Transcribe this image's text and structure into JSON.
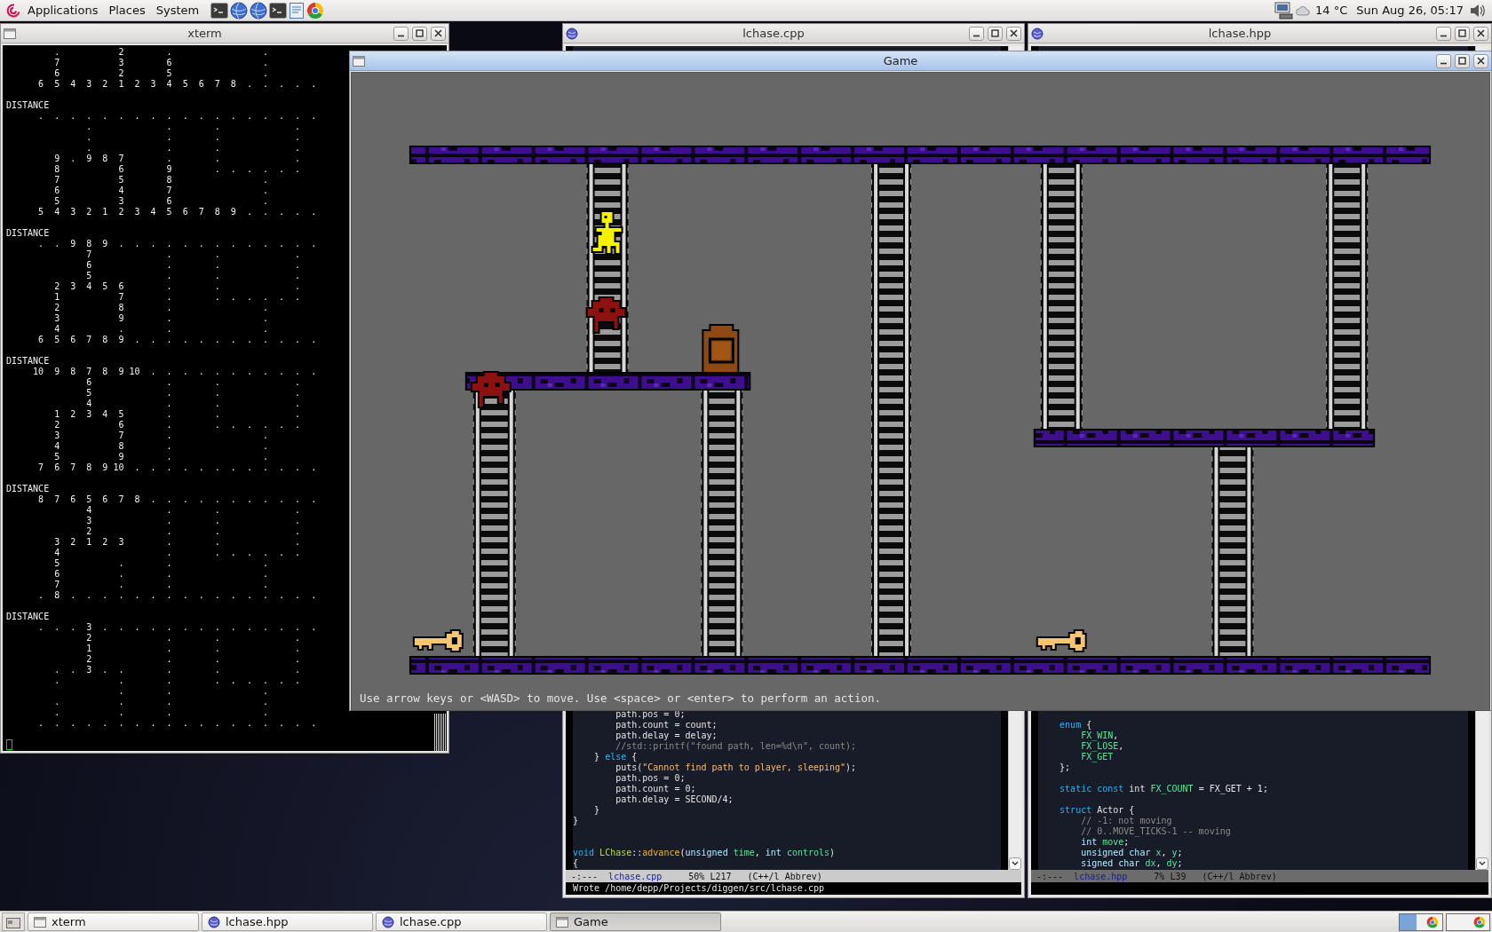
{
  "top_panel": {
    "menus": [
      {
        "label": "Applications"
      },
      {
        "label": "Places"
      },
      {
        "label": "System"
      }
    ],
    "launchers": [
      {
        "kind": "terminal"
      },
      {
        "kind": "globe"
      },
      {
        "kind": "globe"
      },
      {
        "kind": "terminal"
      },
      {
        "kind": "editor"
      },
      {
        "kind": "wheel"
      }
    ],
    "weather": "14 °C",
    "clock": "Sun Aug 26, 05:17"
  },
  "windows": [
    {
      "kind": "terminal",
      "title": "xterm",
      "focused": false,
      "blocks": [
        {
          "lines": [
            "         .           2        .                 .",
            "         7           3        6                 .",
            "         6           2        5                 .",
            "      6  5  4  3  2  1  2  3  4  5  6  7  8  .  .  .  .  ."
          ]
        },
        {
          "heading": "DISTANCE",
          "lines": [
            "      .  .  .  .  .  .  .  .  .  .  .  .  .  .  .  .  .  .",
            "               .              .        .              .",
            "               .              .        .              .",
            "               .              .        .              .",
            "         9  .  9  8  7        .        .              .",
            "         8           6        9        .  .  .  .  .  .",
            "         7           5        8                 .",
            "         6           4        7                 .",
            "         5           3        6                 .",
            "      5  4  3  2  1  2  3  4  5  6  7  8  9  .  .  .  .  ."
          ]
        },
        {
          "heading": "DISTANCE",
          "lines": [
            "      .  .  9  8  9  .  .  .  .  .  .  .  .  .  .  .  .  .",
            "               7              .        .              .",
            "               6              .        .              .",
            "               5              .        .              .",
            "         2  3  4  5  6        .        .              .",
            "         1           7        .        .  .  .  .  .  .",
            "         2           8        .                 .",
            "         3           9        .                 .",
            "         4           .        .                 .",
            "      6  5  6  7  8  9  .  .  .  .  .  .  .  .  .  .  .  ."
          ]
        },
        {
          "heading": "DISTANCE",
          "lines": [
            "     10  9  8  7  8  9 10  .  .  .  .  .  .  .  .  .  .  .",
            "               6              .        .              .",
            "               5              .        .              .",
            "               4              .        .              .",
            "         1  2  3  4  5        .        .              .",
            "         2           6        .        .  .  .  .  .  .",
            "         3           7        .                 .",
            "         4           8        .                 .",
            "         5           9        .                 .",
            "      7  6  7  8  9 10  .  .  .  .  .  .  .  .  .  .  .  ."
          ]
        },
        {
          "heading": "DISTANCE",
          "lines": [
            "      8  7  6  5  6  7  8  .  .  .  .  .  .  .  .  .  .  .",
            "               4              .        .              .",
            "               3              .        .              .",
            "               2              .        .              .",
            "         3  2  1  2  3        .        .              .",
            "         4                    .        .  .  .  .  .  .",
            "         5           .        .                 .",
            "         6           .        .                 .",
            "         7           .        .                 .",
            "      .  8  .  .  .  .  .  .  .  .  .  .  .  .  .  .  .  ."
          ]
        },
        {
          "heading": "DISTANCE",
          "lines": [
            "      .  .  .  3  .  .  .  .  .  .  .  .  .  .  .  .  .  .",
            "               2              .        .              .",
            "               1              .        .              .",
            "               2              .        .              .",
            "         .  .  3  .  .        .        .              .",
            "         .           .        .        .  .  .  .  .  .",
            "                     .        .                 .",
            "         .           .        .                 .",
            "         .           .        .                 .",
            "      .  .  .  .  .  .  .  .  .  .  .  .  .  .  .  .  .  ."
          ]
        }
      ]
    },
    {
      "kind": "editor",
      "title": "lchase.cpp",
      "focused": false,
      "code": [
        {
          "kind": "code",
          "tokens": [
            {
              "text": "        path.pos = 0;",
              "kind": "plain"
            }
          ]
        },
        {
          "kind": "code",
          "tokens": [
            {
              "text": "        path.count = count;",
              "kind": "plain"
            }
          ]
        },
        {
          "kind": "code",
          "tokens": [
            {
              "text": "        path.delay = delay;",
              "kind": "plain"
            }
          ]
        },
        {
          "kind": "code",
          "tokens": [
            {
              "text": "        //std::printf(\"found path, len=%d\\n\", count);",
              "kind": "comment"
            }
          ]
        },
        {
          "kind": "code",
          "tokens": [
            {
              "text": "    } ",
              "kind": "plain"
            },
            {
              "text": "else",
              "kind": "keyword"
            },
            {
              "text": " {",
              "kind": "plain"
            }
          ]
        },
        {
          "kind": "code",
          "tokens": [
            {
              "text": "        puts(",
              "kind": "plain"
            },
            {
              "text": "\"Cannot find path to player, sleeping\"",
              "kind": "string"
            },
            {
              "text": ");",
              "kind": "plain"
            }
          ]
        },
        {
          "kind": "code",
          "tokens": [
            {
              "text": "        path.pos = 0;",
              "kind": "plain"
            }
          ]
        },
        {
          "kind": "code",
          "tokens": [
            {
              "text": "        path.count = 0;",
              "kind": "plain"
            }
          ]
        },
        {
          "kind": "code",
          "tokens": [
            {
              "text": "        path.delay = SECOND/4;",
              "kind": "plain"
            }
          ]
        },
        {
          "kind": "code",
          "tokens": [
            {
              "text": "    }",
              "kind": "plain"
            }
          ]
        },
        {
          "kind": "code",
          "tokens": [
            {
              "text": "}",
              "kind": "plain"
            }
          ]
        },
        {
          "kind": "blank"
        },
        {
          "kind": "blank"
        },
        {
          "kind": "code",
          "tokens": [
            {
              "text": "void",
              "kind": "keyword"
            },
            {
              "text": " LChase",
              "kind": "class"
            },
            {
              "text": "::",
              "kind": "plain"
            },
            {
              "text": "advance",
              "kind": "function"
            },
            {
              "text": "(",
              "kind": "plain"
            },
            {
              "text": "unsigned",
              "kind": "type"
            },
            {
              "text": " time",
              "kind": "variable"
            },
            {
              "text": ", ",
              "kind": "plain"
            },
            {
              "text": "int",
              "kind": "type"
            },
            {
              "text": " controls",
              "kind": "variable"
            },
            {
              "text": ")",
              "kind": "plain"
            }
          ]
        },
        {
          "kind": "code",
          "tokens": [
            {
              "text": "{",
              "kind": "plain"
            }
          ]
        }
      ],
      "modeline": {
        "status": "-:---",
        "buffer": "lchase.cpp",
        "position": "50% L217",
        "mode": "(C++/l Abbrev)",
        "active": true
      },
      "echo": "Wrote /home/depp/Projects/diggen/src/lchase.cpp"
    },
    {
      "kind": "editor",
      "title": "lchase.hpp",
      "focused": false,
      "code": [
        {
          "kind": "code",
          "tokens": [
            {
              "text": "    enum",
              "kind": "keyword"
            },
            {
              "text": " {",
              "kind": "plain"
            }
          ]
        },
        {
          "kind": "code",
          "tokens": [
            {
              "text": "        FX_WIN",
              "kind": "variable"
            },
            {
              "text": ",",
              "kind": "plain"
            }
          ]
        },
        {
          "kind": "code",
          "tokens": [
            {
              "text": "        FX_LOSE",
              "kind": "variable"
            },
            {
              "text": ",",
              "kind": "plain"
            }
          ]
        },
        {
          "kind": "code",
          "tokens": [
            {
              "text": "        FX_GET",
              "kind": "variable"
            }
          ]
        },
        {
          "kind": "code",
          "tokens": [
            {
              "text": "    };",
              "kind": "plain"
            }
          ]
        },
        {
          "kind": "blank"
        },
        {
          "kind": "code",
          "tokens": [
            {
              "text": "    static const",
              "kind": "keyword"
            },
            {
              "text": " int",
              "kind": "plain"
            },
            {
              "text": " FX_COUNT",
              "kind": "variable"
            },
            {
              "text": " = FX_GET + 1;",
              "kind": "plain"
            }
          ]
        },
        {
          "kind": "blank"
        },
        {
          "kind": "code",
          "tokens": [
            {
              "text": "    struct",
              "kind": "keyword"
            },
            {
              "text": " Actor {",
              "kind": "plain"
            }
          ]
        },
        {
          "kind": "code",
          "tokens": [
            {
              "text": "        // -1: not moving",
              "kind": "comment"
            }
          ]
        },
        {
          "kind": "code",
          "tokens": [
            {
              "text": "        // 0..MOVE_TICKS-1 -- moving",
              "kind": "comment"
            }
          ]
        },
        {
          "kind": "code",
          "tokens": [
            {
              "text": "        int",
              "kind": "type"
            },
            {
              "text": " move",
              "kind": "variable"
            },
            {
              "text": ";",
              "kind": "plain"
            }
          ]
        },
        {
          "kind": "code",
          "tokens": [
            {
              "text": "        unsigned char",
              "kind": "type"
            },
            {
              "text": " x",
              "kind": "variable"
            },
            {
              "text": ", ",
              "kind": "plain"
            },
            {
              "text": "y",
              "kind": "variable"
            },
            {
              "text": ";",
              "kind": "plain"
            }
          ]
        },
        {
          "kind": "code",
          "tokens": [
            {
              "text": "        signed char",
              "kind": "type"
            },
            {
              "text": " dx",
              "kind": "variable"
            },
            {
              "text": ", ",
              "kind": "plain"
            },
            {
              "text": "dy",
              "kind": "variable"
            },
            {
              "text": ";",
              "kind": "plain"
            }
          ]
        }
      ],
      "modeline": {
        "status": "-:---",
        "buffer": "lchase.hpp",
        "position": "7% L39",
        "mode": "(C++/l Abbrev)",
        "active": false
      }
    },
    {
      "kind": "game",
      "title": "Game",
      "focused": true,
      "instructions": "Use arrow keys or <WASD> to move. Use <space> or <enter> to perform an action."
    }
  ],
  "taskbar": {
    "items": [
      {
        "label": "xterm",
        "kind": "terminal",
        "selected": false
      },
      {
        "label": "lchase.hpp",
        "kind": "editor",
        "selected": false
      },
      {
        "label": "lchase.cpp",
        "kind": "editor",
        "selected": false
      },
      {
        "label": "Game",
        "kind": "game",
        "selected": true
      }
    ]
  }
}
